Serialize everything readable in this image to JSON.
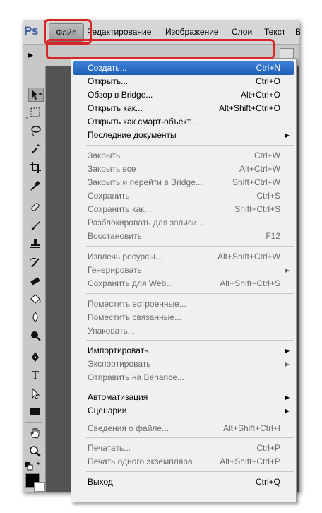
{
  "app": {
    "logo": "Ps",
    "menubar": [
      "Файл",
      "Редактирование",
      "Изображение",
      "Слои",
      "Текст",
      "В"
    ]
  },
  "toolbar": {
    "collapse": "»",
    "tools": [
      "move-tool",
      "rect-marquee-tool",
      "lasso-tool",
      "magic-wand-tool",
      "crop-tool",
      "eyedropper-tool",
      "healing-brush-tool",
      "brush-tool",
      "stamp-tool",
      "history-brush-tool",
      "eraser-tool",
      "paint-bucket-tool",
      "blur-tool",
      "dodge-tool",
      "pen-tool",
      "type-tool",
      "path-select-tool",
      "shape-tool",
      "hand-tool",
      "zoom-tool"
    ],
    "type_glyph": "T",
    "fg_color": "#000000",
    "bg_color": "#ffffff"
  },
  "menu": {
    "items": [
      {
        "label": "Создать...",
        "shortcut": "Ctrl+N",
        "enabled": true,
        "selected": true
      },
      {
        "label": "Открыть...",
        "shortcut": "Ctrl+O",
        "enabled": true
      },
      {
        "label": "Обзор в Bridge...",
        "shortcut": "Alt+Ctrl+O",
        "enabled": true
      },
      {
        "label": "Открыть как...",
        "shortcut": "Alt+Shift+Ctrl+O",
        "enabled": true
      },
      {
        "label": "Открыть как смарт-объект...",
        "shortcut": "",
        "enabled": true
      },
      {
        "label": "Последние документы",
        "shortcut": "",
        "enabled": true,
        "submenu": true
      },
      {
        "label": "Закрыть",
        "shortcut": "Ctrl+W",
        "enabled": false
      },
      {
        "label": "Закрыть все",
        "shortcut": "Alt+Ctrl+W",
        "enabled": false
      },
      {
        "label": "Закрыть и перейти в Bridge...",
        "shortcut": "Shift+Ctrl+W",
        "enabled": false
      },
      {
        "label": "Сохранить",
        "shortcut": "Ctrl+S",
        "enabled": false
      },
      {
        "label": "Сохранить как...",
        "shortcut": "Shift+Ctrl+S",
        "enabled": false
      },
      {
        "label": "Разблокировать для записи...",
        "shortcut": "",
        "enabled": false
      },
      {
        "label": "Восстановить",
        "shortcut": "F12",
        "enabled": false
      },
      {
        "label": "Извлечь ресурсы...",
        "shortcut": "Alt+Shift+Ctrl+W",
        "enabled": false
      },
      {
        "label": "Генерировать",
        "shortcut": "",
        "enabled": false,
        "submenu": true
      },
      {
        "label": "Сохранить для Web...",
        "shortcut": "Alt+Shift+Ctrl+S",
        "enabled": false
      },
      {
        "label": "Поместить встроенные...",
        "shortcut": "",
        "enabled": false
      },
      {
        "label": "Поместить связанные...",
        "shortcut": "",
        "enabled": false
      },
      {
        "label": "Упаковать...",
        "shortcut": "",
        "enabled": false
      },
      {
        "label": "Импортировать",
        "shortcut": "",
        "enabled": true,
        "submenu": true
      },
      {
        "label": "Экспортировать",
        "shortcut": "",
        "enabled": false,
        "submenu": true
      },
      {
        "label": "Отправить на Behance...",
        "shortcut": "",
        "enabled": false
      },
      {
        "label": "Автоматизация",
        "shortcut": "",
        "enabled": true,
        "submenu": true
      },
      {
        "label": "Сценарии",
        "shortcut": "",
        "enabled": true,
        "submenu": true
      },
      {
        "label": "Сведения о файле...",
        "shortcut": "Alt+Shift+Ctrl+I",
        "enabled": false
      },
      {
        "label": "Печатать...",
        "shortcut": "Ctrl+P",
        "enabled": false
      },
      {
        "label": "Печать одного экземпляра",
        "shortcut": "Alt+Shift+Ctrl+P",
        "enabled": false
      },
      {
        "label": "Выход",
        "shortcut": "Ctrl+Q",
        "enabled": true
      }
    ],
    "submenu_arrow": "▶"
  },
  "highlight_color": "#d6262a"
}
